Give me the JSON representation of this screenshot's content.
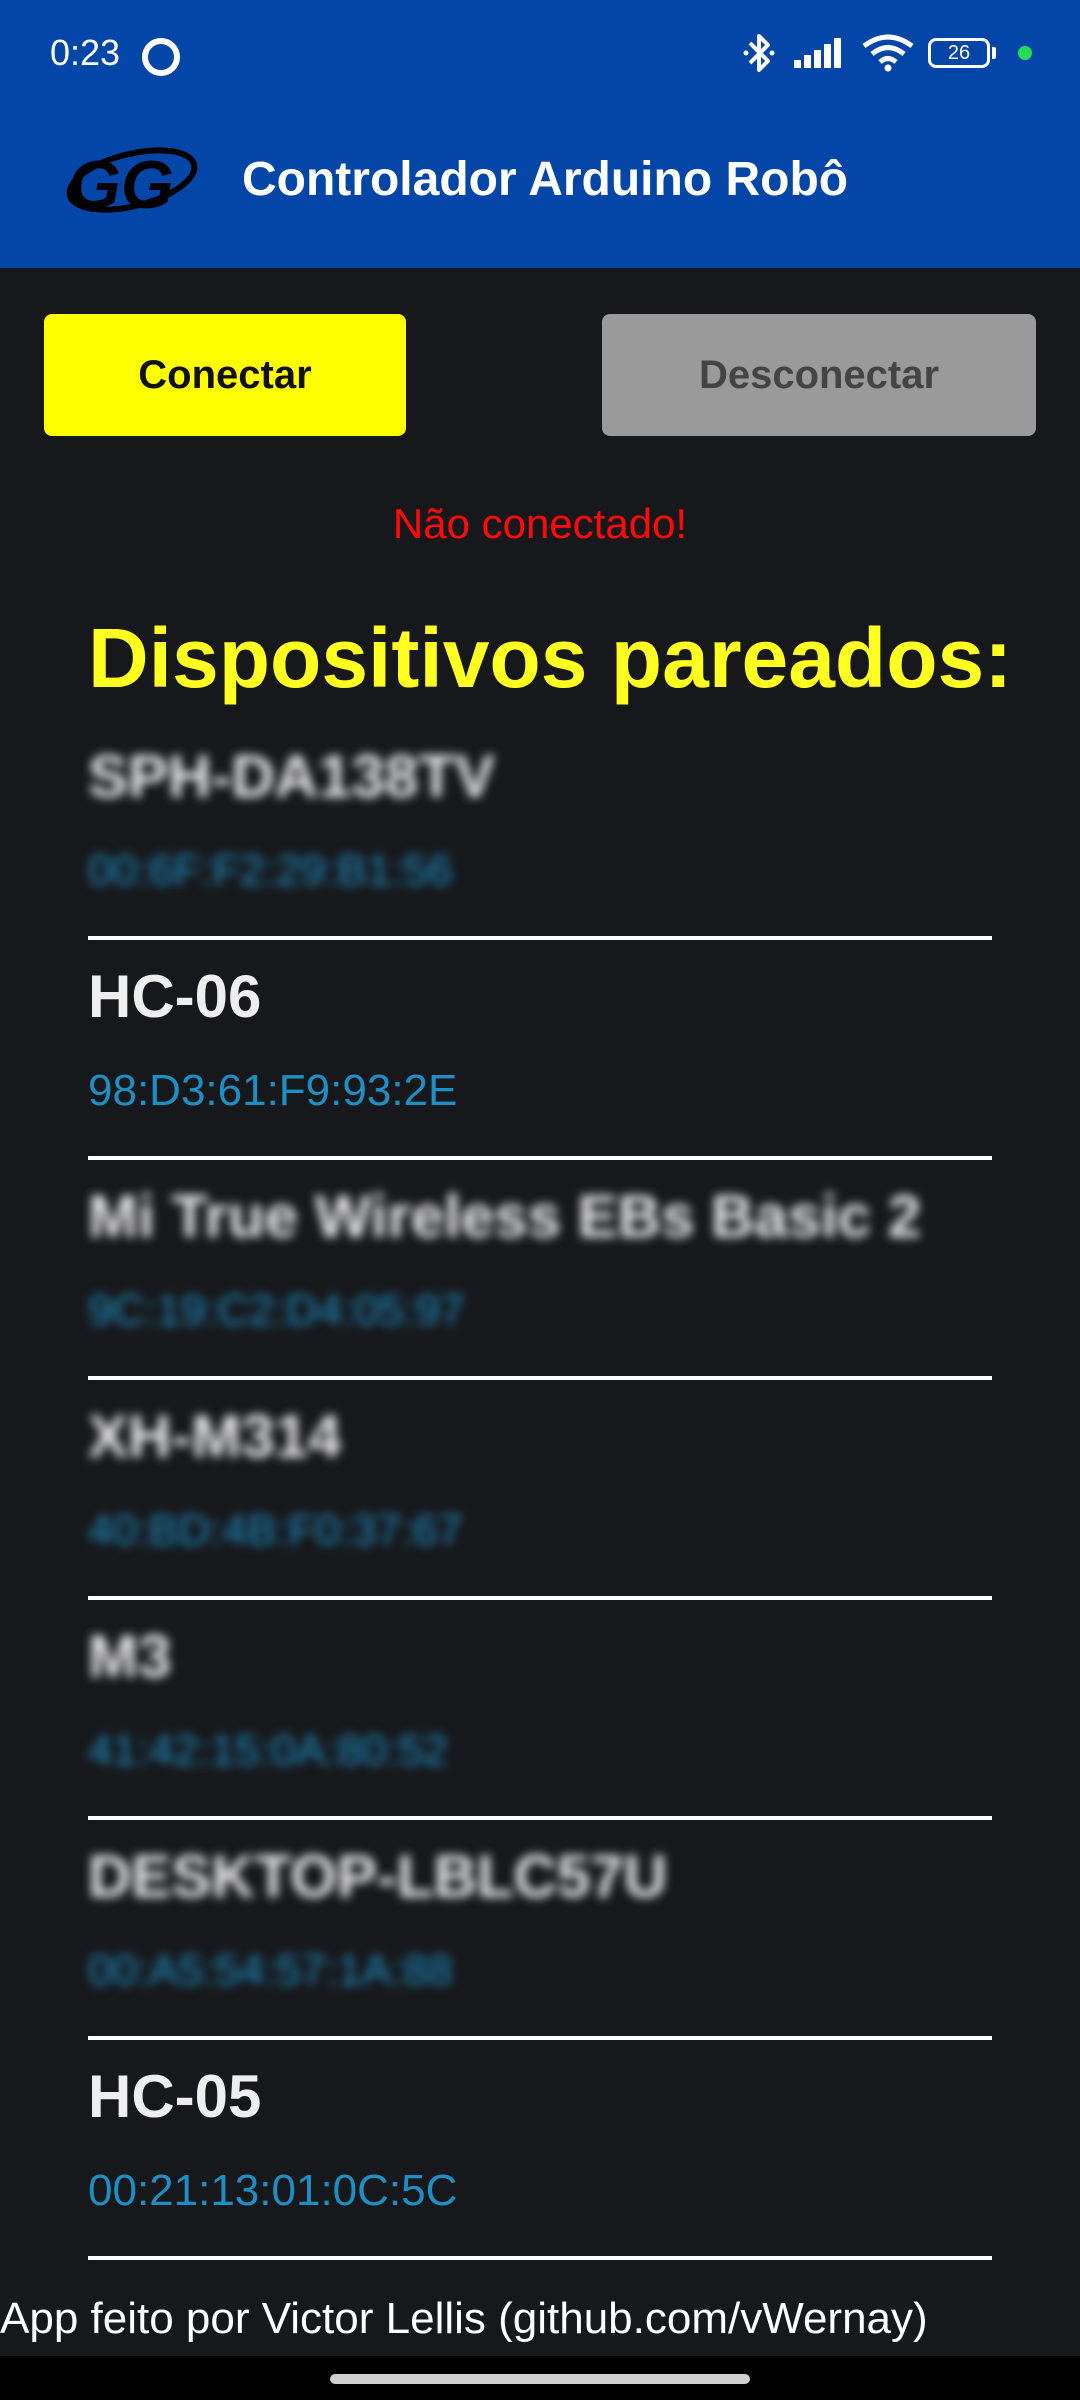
{
  "status_bar": {
    "time": "0:23",
    "battery": "26",
    "icons": [
      "ring-icon",
      "bluetooth-icon",
      "signal-icon",
      "wifi-icon",
      "battery-icon",
      "dot-icon"
    ],
    "dot_color": "#22dd55"
  },
  "app_bar": {
    "title": "Controlador Arduino Robô",
    "logo_icon": "gg-logo",
    "background": "#0446a8"
  },
  "buttons": {
    "connect_label": "Conectar",
    "disconnect_label": "Desconectar",
    "connect_color": "#ffff00",
    "disconnect_color": "#9a9a9a"
  },
  "connection_status": "Não conectado!",
  "section_title": "Dispositivos pareados:",
  "devices": [
    {
      "name": "SPH-DA138TV",
      "mac": "00:6F:F2:29:B1:56"
    },
    {
      "name": "HC-06",
      "mac": "98:D3:61:F9:93:2E"
    },
    {
      "name": "Mi True Wireless EBs Basic 2",
      "mac": "9C:19:C2:D4:05:97"
    },
    {
      "name": "XH-M314",
      "mac": "40:BD:4B:F0:37:67"
    },
    {
      "name": "M3",
      "mac": "41:42:15:0A:80:52"
    },
    {
      "name": "DESKTOP-LBLC57U",
      "mac": "00:A5:54:57:1A:88"
    },
    {
      "name": "HC-05",
      "mac": "00:21:13:01:0C:5C"
    }
  ],
  "footer": "App feito por Victor Lellis (github.com/vWernay)"
}
